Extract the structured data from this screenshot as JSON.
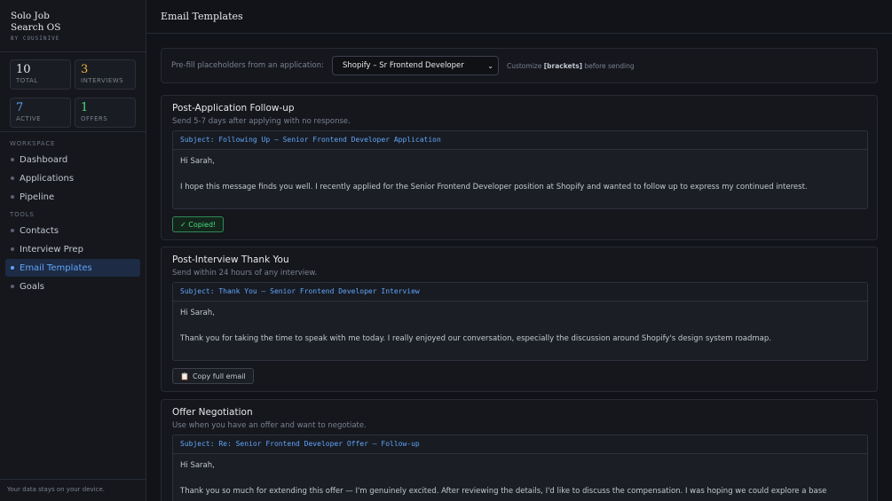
{
  "brand": {
    "title_line1": "Solo Job",
    "title_line2": "Search OS",
    "subtitle": "BY COUSINIVE"
  },
  "stats": [
    {
      "value": "10",
      "label": "TOTAL",
      "color": "#e5e7eb"
    },
    {
      "value": "3",
      "label": "INTERVIEWS",
      "color": "#f2b33d"
    },
    {
      "value": "7",
      "label": "ACTIVE",
      "color": "#60a5fa"
    },
    {
      "value": "1",
      "label": "OFFERS",
      "color": "#4ade80"
    }
  ],
  "nav": {
    "workspace_label": "WORKSPACE",
    "workspace_items": [
      "Dashboard",
      "Applications",
      "Pipeline"
    ],
    "tools_label": "TOOLS",
    "tools_items": [
      "Contacts",
      "Interview Prep",
      "Email Templates",
      "Goals"
    ],
    "active_item": "Email Templates"
  },
  "footer": "Your data stays on your device.",
  "page_title": "Email Templates",
  "prefill": {
    "label": "Pre-fill placeholders from an application:",
    "selected": "Shopify – Sr Frontend Developer",
    "hint_prefix": "Customize",
    "hint_bold": "[brackets]",
    "hint_suffix": "before sending"
  },
  "templates": [
    {
      "title": "Post-Application Follow-up",
      "description": "Send 5-7 days after applying with no response.",
      "subject": "Subject: Following Up – Senior Frontend Developer Application",
      "greeting": "Hi Sarah,",
      "body": "I hope this message finds you well. I recently applied for the Senior Frontend Developer position at Shopify and wanted to follow up to express my continued interest.",
      "button_label": "✓ Copied!",
      "button_state": "copied"
    },
    {
      "title": "Post-Interview Thank You",
      "description": "Send within 24 hours of any interview.",
      "subject": "Subject: Thank You – Senior Frontend Developer Interview",
      "greeting": "Hi Sarah,",
      "body": "Thank you for taking the time to speak with me today. I really enjoyed our conversation, especially the discussion around Shopify's design system roadmap.",
      "button_label": "Copy full email",
      "button_state": "normal"
    },
    {
      "title": "Offer Negotiation",
      "description": "Use when you have an offer and want to negotiate.",
      "subject": "Subject: Re: Senior Frontend Developer Offer – Follow-up",
      "greeting": "Hi Sarah,",
      "body": "Thank you so much for extending this offer — I'm genuinely excited. After reviewing the details, I'd like to discuss the compensation. I was hoping we could explore a base"
    }
  ]
}
